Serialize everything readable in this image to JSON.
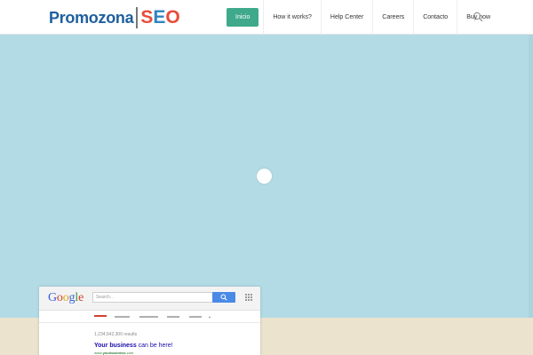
{
  "header": {
    "logo_left": "Promozona",
    "logo_right": [
      "S",
      "E",
      "O"
    ],
    "nav": [
      "Inicio",
      "How it works?",
      "Help Center",
      "Careers",
      "Contacto",
      "Buy now"
    ],
    "search_icon": "search-icon"
  },
  "colors": {
    "accent": "#3fa98b",
    "hero_bg": "#b3dbe5",
    "ground": "#ebe3ce"
  },
  "mockup": {
    "google_logo": [
      "G",
      "o",
      "o",
      "g",
      "l",
      "e"
    ],
    "search_placeholder": "Search...",
    "results_count": "1,234,542,300 results",
    "result_title_bold": "Your business",
    "result_title_rest": " can be here!",
    "result_url_pre": "www.",
    "result_url_bold": "yourbusiness",
    "result_url_post": ".com"
  }
}
